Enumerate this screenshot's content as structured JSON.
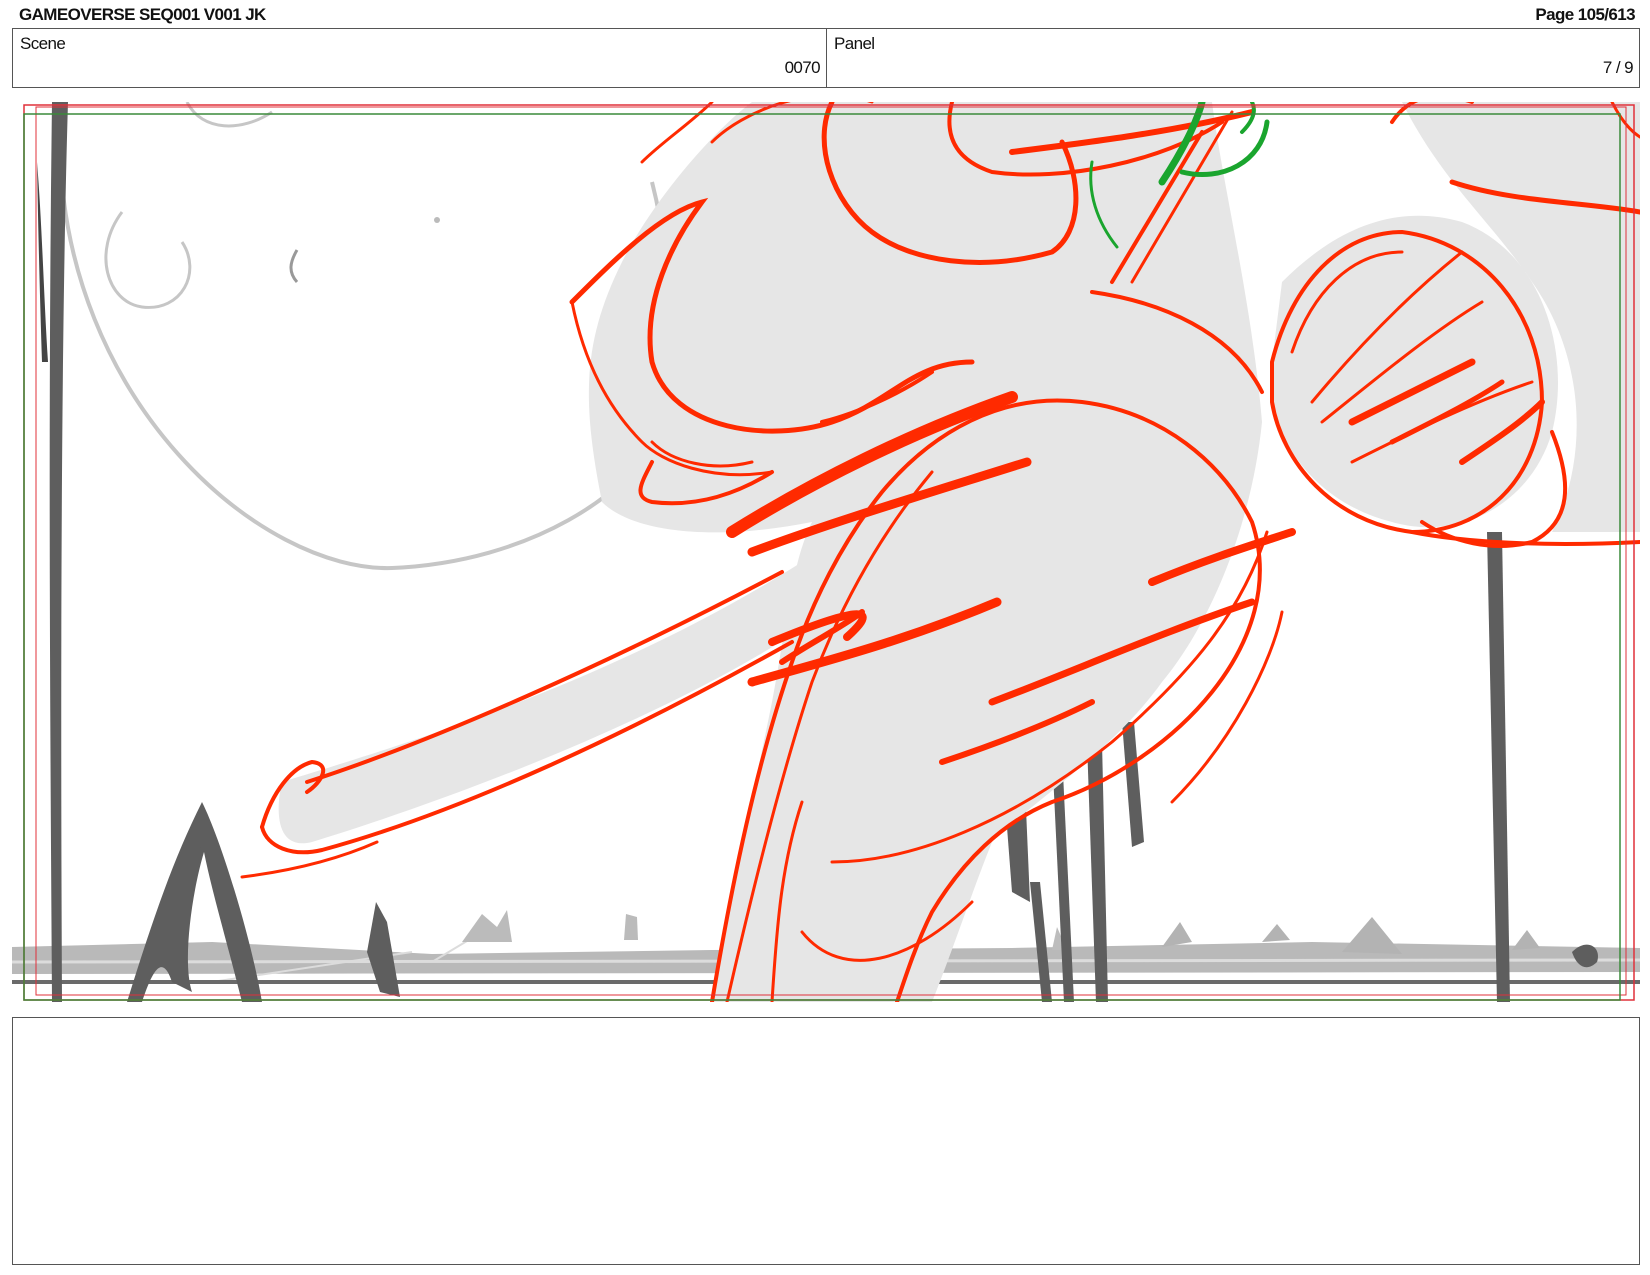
{
  "header": {
    "title": "GAMEOVERSE SEQ001 V001 JK",
    "page": "Page 105/613"
  },
  "info": {
    "scene_label": "Scene",
    "scene_value": "0070",
    "panel_label": "Panel",
    "panel_value": "7 / 9"
  },
  "colors": {
    "sketch_red": "#ff2a00",
    "sketch_green": "#1aa52e",
    "safe_frame_green": "#3a8a3a",
    "frame_red": "#e0303a",
    "fill_gray": "#e6e6e6",
    "dark_gray": "#5a5a5a",
    "light_gray": "#c4c4c4"
  }
}
